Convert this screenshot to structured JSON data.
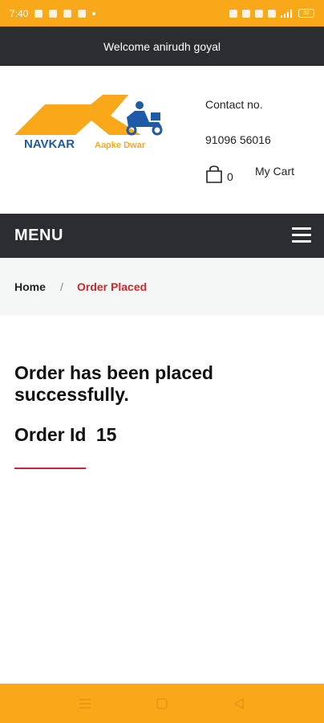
{
  "status_bar": {
    "time": "7:40",
    "battery": "32"
  },
  "header": {
    "welcome": "Welcome anirudh goyal",
    "logo_text": "NAVKAR",
    "logo_tagline": "Aapke Dwar",
    "contact_label": "Contact no.",
    "contact_number": "91096 56016",
    "cart_count": "0",
    "my_cart_label": "My Cart"
  },
  "menu": {
    "label": "MENU"
  },
  "breadcrumb": {
    "home": "Home",
    "separator": "/",
    "current": "Order Placed"
  },
  "content": {
    "success_message": "Order has been placed successfully.",
    "order_id_label": "Order Id",
    "order_id_value": "15"
  },
  "colors": {
    "brand_orange": "#f9a81a",
    "dark_bar": "#2b2d30",
    "accent_red": "#d0262b",
    "logo_blue": "#1f5aa8"
  },
  "icons": {
    "cart": "shopping-bag-icon",
    "menu": "hamburger-icon",
    "nav_recents": "recents-icon",
    "nav_home": "home-icon",
    "nav_back": "back-icon"
  }
}
